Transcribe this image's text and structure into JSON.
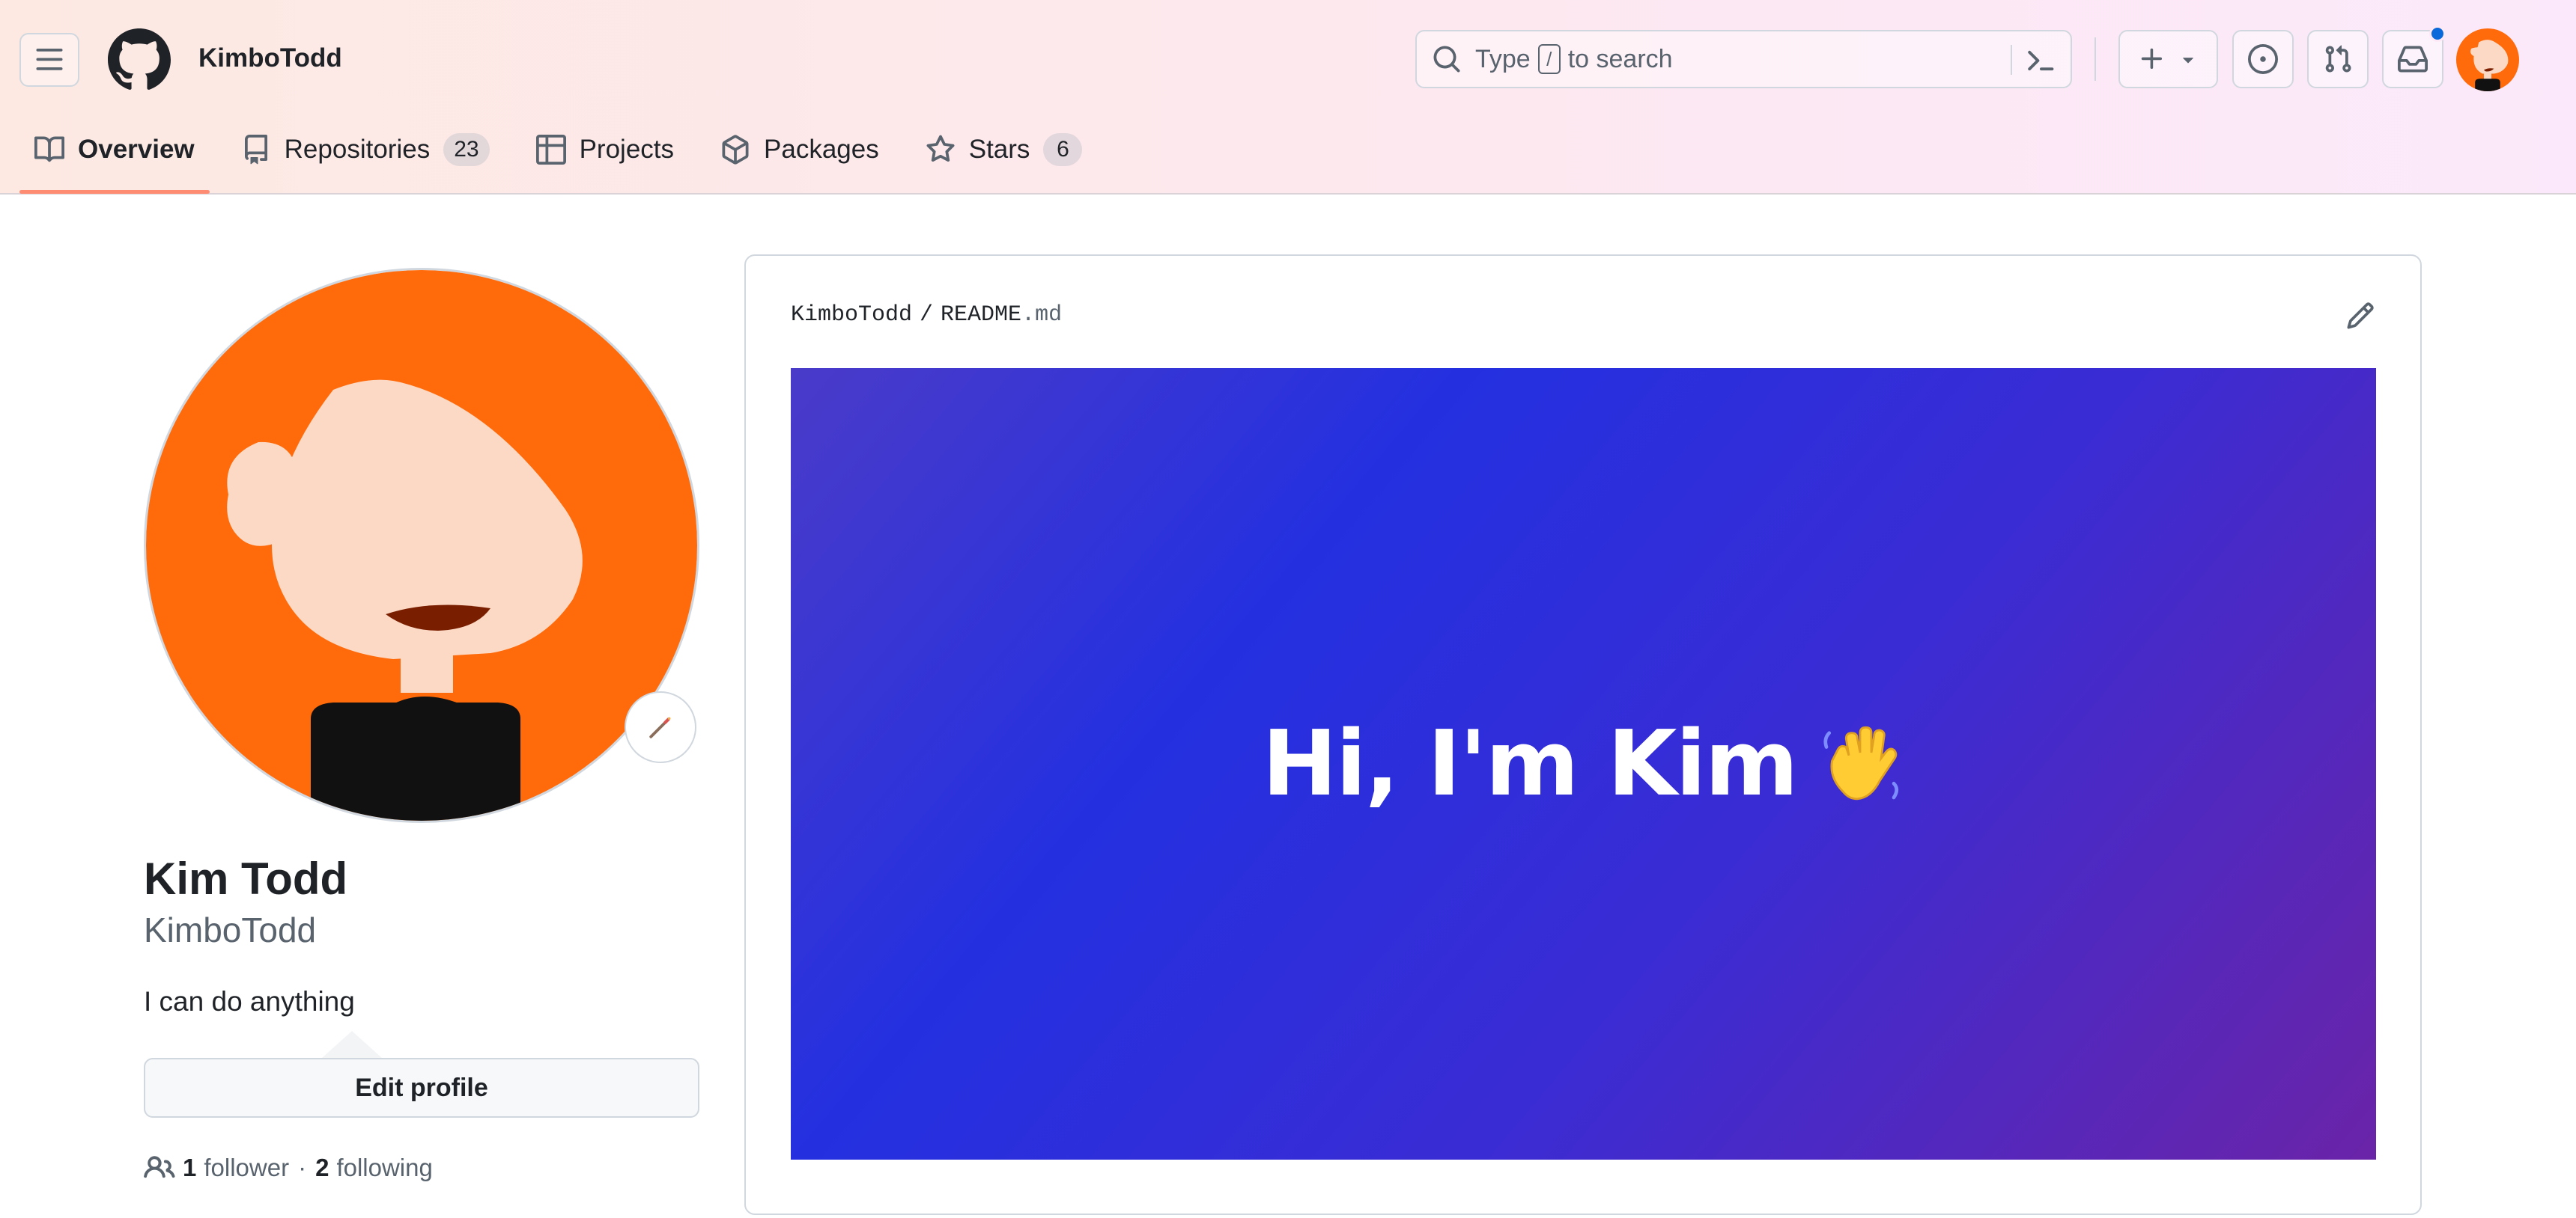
{
  "header": {
    "owner": "KimboTodd",
    "search": {
      "before": "Type",
      "key": "/",
      "after": "to search"
    },
    "icons": {
      "menu": "hamburger-menu-icon",
      "logo": "github-octocat-icon",
      "search": "search-icon",
      "command": "command-palette-icon",
      "create": "plus-icon",
      "issues": "issue-opened-icon",
      "pulls": "git-pull-request-icon",
      "inbox": "inbox-icon"
    }
  },
  "tabs": [
    {
      "label": "Overview",
      "icon": "book-icon",
      "selected": true
    },
    {
      "label": "Repositories",
      "icon": "repo-icon",
      "count": "23"
    },
    {
      "label": "Projects",
      "icon": "table-icon"
    },
    {
      "label": "Packages",
      "icon": "package-icon"
    },
    {
      "label": "Stars",
      "icon": "star-icon",
      "count": "6"
    }
  ],
  "profile": {
    "full_name": "Kim Todd",
    "login": "KimboTodd",
    "bio": "I can do anything",
    "edit_label": "Edit profile",
    "followers_count": "1",
    "followers_label": "follower",
    "separator": "·",
    "following_count": "2",
    "following_label": "following"
  },
  "readme": {
    "owner": "KimboTodd",
    "slash": "/",
    "file_base": "README",
    "file_ext": ".md",
    "banner_text": "Hi, I'm Kim",
    "banner_emoji": "waving-hand-icon"
  },
  "colors": {
    "accent_underline": "#fd8c73",
    "avatar_orange": "#ff6a0a",
    "notification": "#0969da",
    "banner_blue": "#2430e0",
    "banner_purple": "#6a24a8"
  }
}
